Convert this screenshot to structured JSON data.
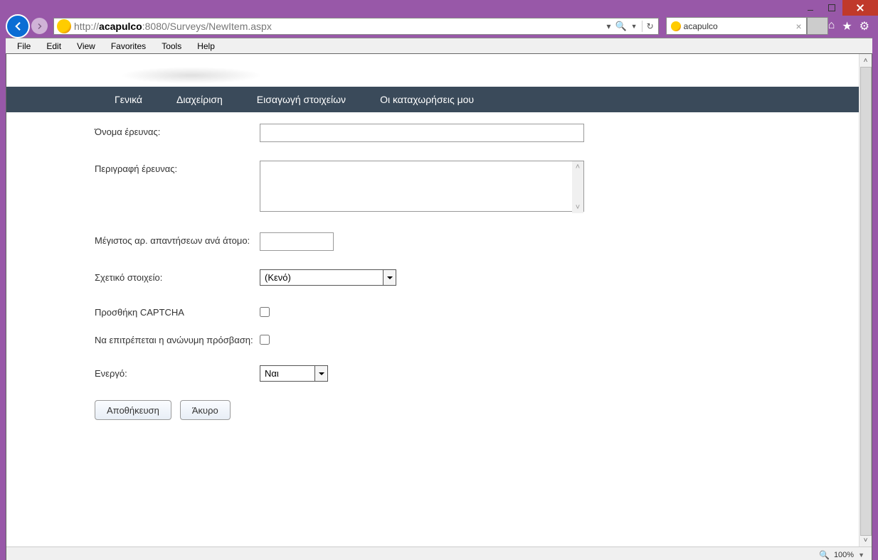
{
  "window": {
    "url_prefix": "http://",
    "url_host": "acapulco",
    "url_suffix": ":8080/Surveys/NewItem.aspx",
    "tab_title": "acapulco"
  },
  "menubar": {
    "file": "File",
    "edit": "Edit",
    "view": "View",
    "favorites": "Favorites",
    "tools": "Tools",
    "help": "Help"
  },
  "topnav": {
    "general": "Γενικά",
    "manage": "Διαχείριση",
    "import": "Εισαγωγή στοιχείων",
    "myentries": "Οι καταχωρήσεις μου"
  },
  "form": {
    "name_label": "Όνομα έρευνας:",
    "name_value": "",
    "desc_label": "Περιγραφή έρευνας:",
    "desc_value": "",
    "max_label": "Μέγιστος αρ. απαντήσεων ανά άτομο:",
    "max_value": "",
    "rel_label": "Σχετικό στοιχείο:",
    "rel_value": "(Κενό)",
    "captcha_label": "Προσθήκη CAPTCHA",
    "anon_label": "Να επιτρέπεται η ανώνυμη πρόσβαση:",
    "active_label": "Ενεργό:",
    "active_value": "Ναι",
    "save": "Αποθήκευση",
    "cancel": "Άκυρο"
  },
  "statusbar": {
    "zoom": "100%"
  }
}
